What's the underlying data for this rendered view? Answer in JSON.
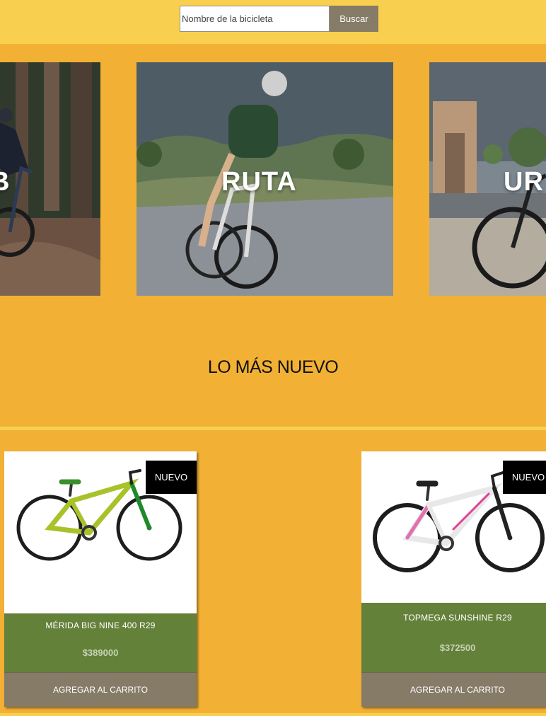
{
  "search": {
    "placeholder": "Nombre de la bicicleta",
    "button_label": "Buscar"
  },
  "categories": [
    {
      "label": "B",
      "icon": "mtb-photo"
    },
    {
      "label": "RUTA",
      "icon": "road-bike-photo"
    },
    {
      "label": "UR",
      "icon": "urban-bike-photo"
    }
  ],
  "section": {
    "title": "LO MÁS NUEVO"
  },
  "products": [
    {
      "badge": "NUEVO",
      "name": "MÉRIDA BIG NINE 400 R29",
      "price": "$389000",
      "button_label": "AGREGAR AL CARRITO",
      "bike_color": "#a8c22a"
    },
    {
      "badge": "NUEVO",
      "name": "TOPMEGA SUNSHINE R29",
      "price": "$372500",
      "button_label": "AGREGAR AL CARRITO",
      "bike_color": "#f0f0f0"
    }
  ],
  "colors": {
    "header_bg": "#f9cf50",
    "page_bg": "#f2b134",
    "card_info_bg": "#64813a",
    "button_bg": "#857b67"
  }
}
